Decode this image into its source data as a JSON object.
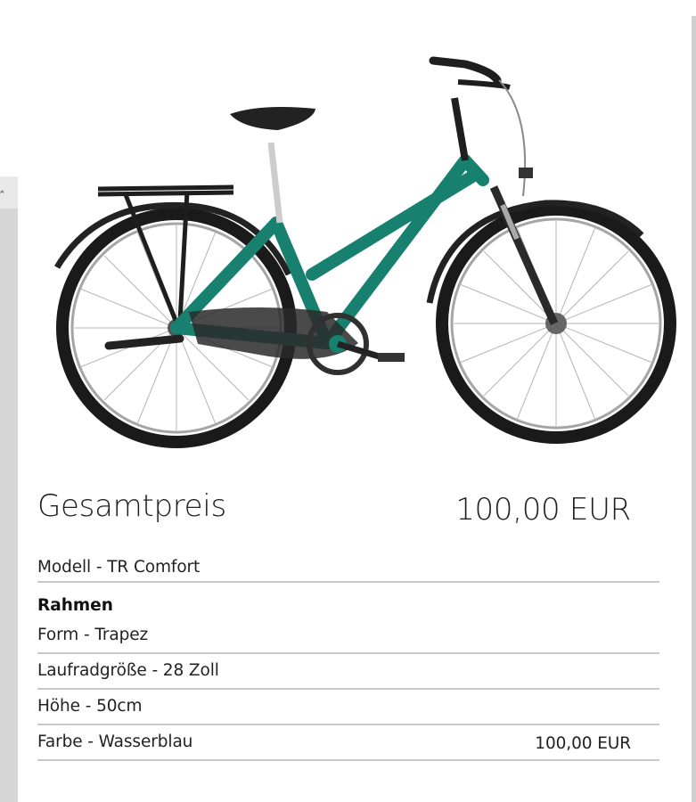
{
  "summary": {
    "total_label": "Gesamtpreis",
    "total_price": "100,00 EUR",
    "model": "Modell - TR Comfort",
    "section": "Rahmen",
    "items": [
      {
        "label": "Form - Trapez",
        "price": ""
      },
      {
        "label": "Laufradgröße - 28 Zoll",
        "price": ""
      },
      {
        "label": "Höhe - 50cm",
        "price": ""
      },
      {
        "label": "Farbe - Wasserblau",
        "price": "100,00 EUR"
      }
    ]
  },
  "colors": {
    "frame": "#17806f",
    "tire": "#1a1a1a",
    "rim": "#9a9a9a",
    "divider": "#c8c8c8"
  },
  "icons": {
    "rail": "chevron-up-icon"
  }
}
